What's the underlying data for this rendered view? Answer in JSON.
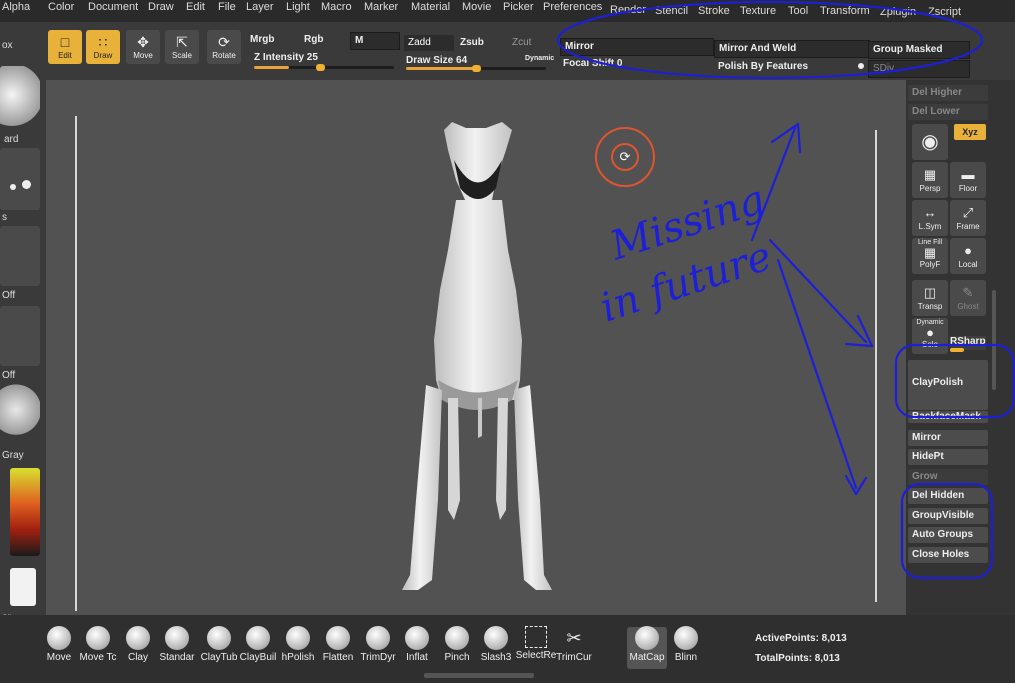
{
  "menu": [
    "Alpha",
    "Color",
    "Document",
    "Draw",
    "Edit",
    "File",
    "Layer",
    "Light",
    "Macro",
    "Marker",
    "Material",
    "Movie",
    "Picker",
    "Preferences",
    "Render",
    "Stencil",
    "Stroke",
    "Texture",
    "Tool",
    "Transform",
    "Zplugin",
    "Zscript"
  ],
  "toolbar": {
    "edit": "Edit",
    "draw": "Draw",
    "move": "Move",
    "scale": "Scale",
    "rotate": "Rotate",
    "mrgb": "Mrgb",
    "rgb": "Rgb",
    "m": "M",
    "zadd": "Zadd",
    "zsub": "Zsub",
    "zcut": "Zcut",
    "z_intensity": "Z Intensity 25",
    "draw_size": "Draw Size 64",
    "dynamic": "Dynamic",
    "focal_shift": "Focal Shift 0",
    "mirror": "Mirror",
    "mirror_and_weld": "Mirror And Weld",
    "group_masked": "Group Masked",
    "polish_by_features": "Polish By Features",
    "sdiv": "SDiv",
    "z_intensity_value": 25,
    "draw_size_value": 64
  },
  "left": {
    "ox": "ox",
    "ard": "ard",
    "s": "s",
    "off1": "Off",
    "off2": "Off",
    "gray": "Gray",
    "or": "or"
  },
  "right": {
    "del_higher": "Del Higher",
    "del_lower": "Del Lower",
    "xyz": "Xyz",
    "persp": "Persp",
    "floor": "Floor",
    "lsym": "L.Sym",
    "frame": "Frame",
    "polyf_top": "Line Fill",
    "polyf": "PolyF",
    "local": "Local",
    "transp": "Transp",
    "ghost": "Ghost",
    "dynamic": "Dynamic",
    "solo": "Solo",
    "rsharp": "RSharp",
    "claypolish": "ClayPolish",
    "backfacemask": "BackfaceMask",
    "mirror": "Mirror",
    "hidept": "HidePt",
    "grow": "Grow",
    "del_hidden": "Del Hidden",
    "group_visible": "GroupVisible",
    "auto_groups": "Auto Groups",
    "close_holes": "Close Holes"
  },
  "brushes": [
    "Move",
    "Move Tc",
    "Clay",
    "Standar",
    "ClayTub",
    "ClayBuil",
    "hPolish",
    "Flatten",
    "TrimDyr",
    "Inflat",
    "Pinch",
    "Slash3",
    "SelectRe",
    "TrimCur"
  ],
  "materials": [
    "MatCap",
    "Blinn"
  ],
  "stats": {
    "active_points": "ActivePoints: 8,013",
    "total_points": "TotalPoints: 8,013"
  },
  "annotation": {
    "line1": "Missing",
    "line2": "in future"
  },
  "colors": {
    "accent": "#e8b23a",
    "pen": "#1d1fd8",
    "canvas": "#525252"
  }
}
